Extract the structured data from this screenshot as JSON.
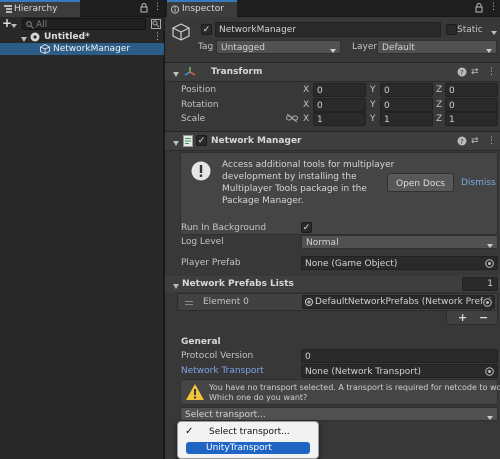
{
  "hierarchy": {
    "tab_label": "Hierarchy",
    "add_label": "+",
    "search_placeholder": "All",
    "scene_name": "Untitled*",
    "objects": [
      {
        "label": "NetworkManager"
      }
    ]
  },
  "inspector": {
    "tab_label": "Inspector",
    "object_name": "NetworkManager",
    "static_label": "Static",
    "tag_label": "Tag",
    "tag_value": "Untagged",
    "layer_label": "Layer",
    "layer_value": "Default",
    "transform": {
      "title": "Transform",
      "position_label": "Position",
      "rotation_label": "Rotation",
      "scale_label": "Scale",
      "x_label": "X",
      "y_label": "Y",
      "z_label": "Z",
      "position": {
        "x": "0",
        "y": "0",
        "z": "0"
      },
      "rotation": {
        "x": "0",
        "y": "0",
        "z": "0"
      },
      "scale": {
        "x": "1",
        "y": "1",
        "z": "1"
      }
    },
    "network_manager": {
      "title": "Network Manager",
      "info_line1": "Access additional tools for multiplayer",
      "info_line2": "development by installing the",
      "info_line3": "Multiplayer Tools package in the",
      "info_line4": "Package Manager.",
      "open_docs_label": "Open Docs",
      "dismiss_label": "Dismiss",
      "run_in_background_label": "Run In Background",
      "run_in_background_check": "✓",
      "log_level_label": "Log Level",
      "log_level_value": "Normal",
      "player_prefab_label": "Player Prefab",
      "player_prefab_value": "None (Game Object)",
      "prefab_lists_label": "Network Prefabs Lists",
      "prefab_lists_count": "1",
      "element0_label": "Element 0",
      "element0_value": "DefaultNetworkPrefabs (Network Prefal",
      "plus_label": "+",
      "minus_label": "−",
      "general_label": "General",
      "protocol_version_label": "Protocol Version",
      "protocol_version_value": "0",
      "network_transport_label": "Network Transport",
      "network_transport_value": "None (Network Transport)",
      "warning_line1": "You have no transport selected. A transport is required for netcode to work.",
      "warning_line2": "Which one do you want?",
      "select_transport_value": "Select transport..."
    }
  },
  "menu": {
    "items": [
      {
        "label": "Select transport...",
        "check": "✓"
      },
      {
        "label": "UnityTransport"
      }
    ]
  },
  "colors": {
    "selection_blue": "#2c5d87",
    "accent_link": "#7ba6e6",
    "menu_highlight": "#1f66c4",
    "warning_yellow": "#f0c53a"
  }
}
